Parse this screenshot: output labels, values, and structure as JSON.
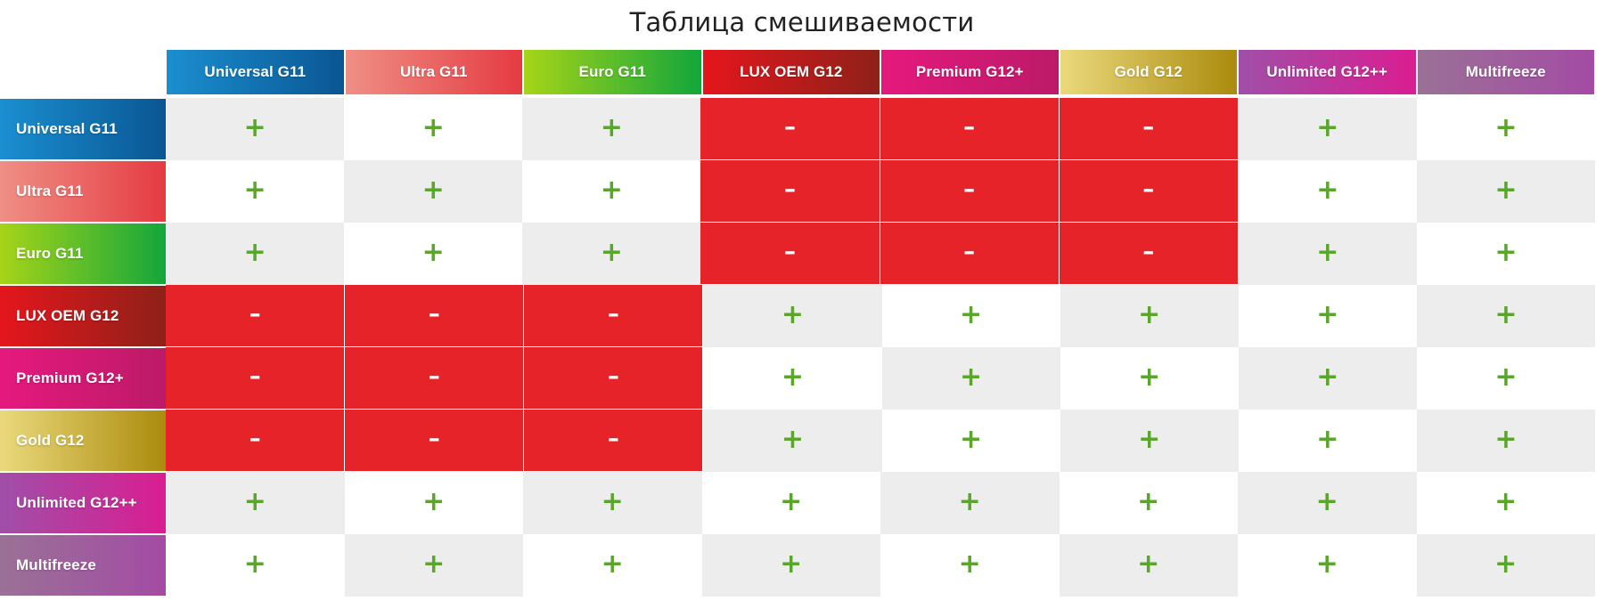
{
  "title": "Таблица смешиваемости",
  "symbols": {
    "compatible": "+",
    "incompatible": "–"
  },
  "colors": {
    "compatible_symbol": "#5aa52b",
    "incompatible_cell": "#e52329",
    "incompatible_symbol": "#ffffff",
    "cell_light": "#ededed",
    "cell_white": "#ffffff",
    "title_text": "#222222"
  },
  "products": [
    {
      "label": "Universal G11",
      "gradient_from": "#1b8fd0",
      "gradient_to": "#0a5693"
    },
    {
      "label": "Ultra G11",
      "gradient_from": "#ef8f85",
      "gradient_to": "#e53b42"
    },
    {
      "label": "Euro G11",
      "gradient_from": "#a6d418",
      "gradient_to": "#13a63c"
    },
    {
      "label": "LUX OEM G12",
      "gradient_from": "#e5161d",
      "gradient_to": "#8e2119"
    },
    {
      "label": "Premium G12+",
      "gradient_from": "#e5197d",
      "gradient_to": "#bc1a68"
    },
    {
      "label": "Gold G12",
      "gradient_from": "#ead97c",
      "gradient_to": "#ab8b0d"
    },
    {
      "label": "Unlimited G12++",
      "gradient_from": "#a04fa8",
      "gradient_to": "#da1d91"
    },
    {
      "label": "Multifreeze",
      "gradient_from": "#9a7196",
      "gradient_to": "#a44ba4"
    }
  ],
  "columns": [
    "Universal G11",
    "Ultra G11",
    "Euro G11",
    "LUX OEM G12",
    "Premium G12+",
    "Gold G12",
    "Unlimited G12++",
    "Multifreeze"
  ],
  "rows": [
    "Universal G11",
    "Ultra G11",
    "Euro G11",
    "LUX OEM G12",
    "Premium G12+",
    "Gold G12",
    "Unlimited G12++",
    "Multifreeze"
  ],
  "matrix": [
    [
      "+",
      "+",
      "+",
      "-",
      "-",
      "-",
      "+",
      "+"
    ],
    [
      "+",
      "+",
      "+",
      "-",
      "-",
      "-",
      "+",
      "+"
    ],
    [
      "+",
      "+",
      "+",
      "-",
      "-",
      "-",
      "+",
      "+"
    ],
    [
      "-",
      "-",
      "-",
      "+",
      "+",
      "+",
      "+",
      "+"
    ],
    [
      "-",
      "-",
      "-",
      "+",
      "+",
      "+",
      "+",
      "+"
    ],
    [
      "-",
      "-",
      "-",
      "+",
      "+",
      "+",
      "+",
      "+"
    ],
    [
      "+",
      "+",
      "+",
      "+",
      "+",
      "+",
      "+",
      "+"
    ],
    [
      "+",
      "+",
      "+",
      "+",
      "+",
      "+",
      "+",
      "+"
    ]
  ]
}
